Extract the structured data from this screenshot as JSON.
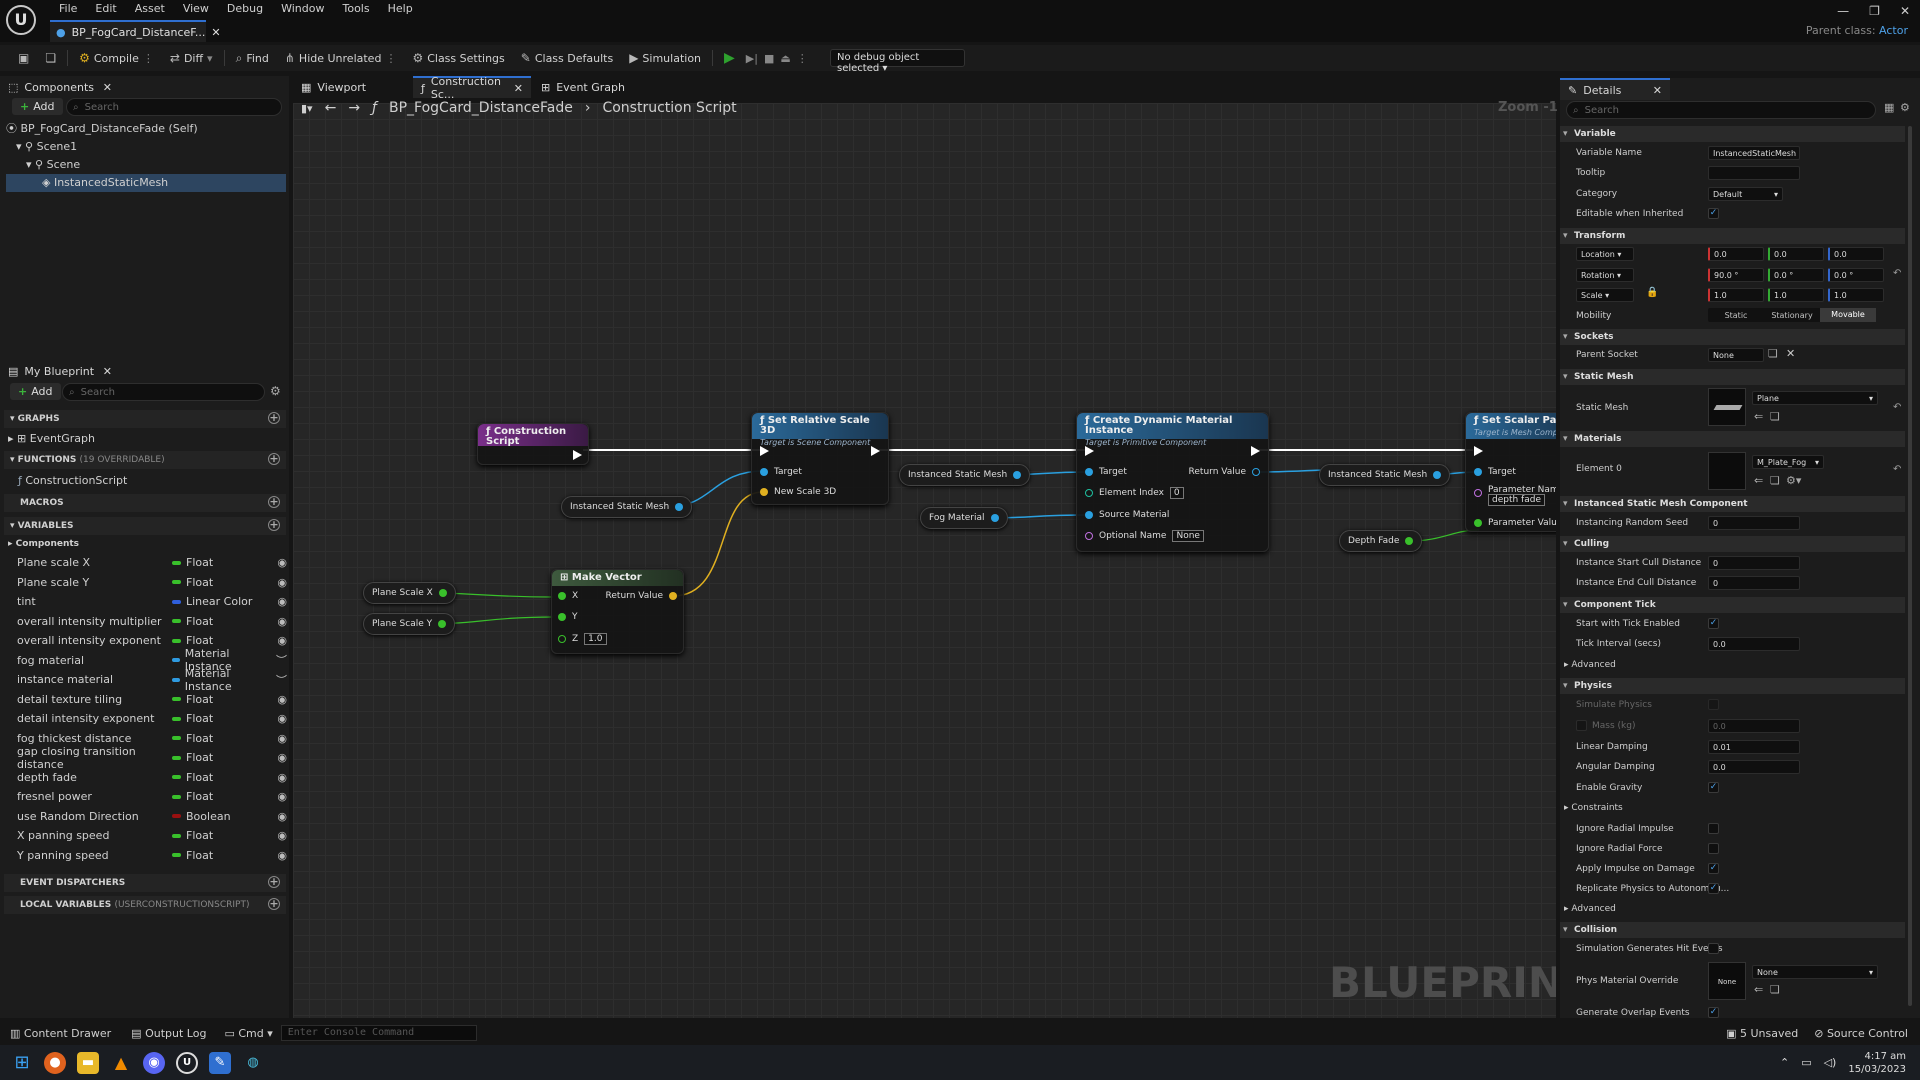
{
  "menu": [
    "File",
    "Edit",
    "Asset",
    "View",
    "Debug",
    "Window",
    "Tools",
    "Help"
  ],
  "doc_tab": "BP_FogCard_DistanceF...",
  "parent_class": {
    "label": "Parent class:",
    "value": "Actor"
  },
  "toolbar": {
    "compile": "Compile",
    "diff": "Diff",
    "find": "Find",
    "hide_unrelated": "Hide Unrelated",
    "class_settings": "Class Settings",
    "class_defaults": "Class Defaults",
    "simulation": "Simulation",
    "debug_object": "No debug object selected"
  },
  "components": {
    "tab": "Components",
    "add": "Add",
    "search": "Search",
    "tree": [
      "BP_FogCard_DistanceFade (Self)",
      "Scene1",
      "Scene",
      "InstancedStaticMesh"
    ]
  },
  "my_blueprint": {
    "tab": "My Blueprint",
    "add": "Add",
    "search": "Search",
    "graphs": "GRAPHS",
    "event_graph": "EventGraph",
    "functions": "FUNCTIONS",
    "functions_count": "(19 OVERRIDABLE)",
    "construction_script": "ConstructionScript",
    "macros": "MACROS",
    "variables": "VARIABLES",
    "components_cat": "Components",
    "vars": [
      {
        "name": "Plane scale X",
        "type": "Float",
        "color": "#39c02b"
      },
      {
        "name": "Plane scale Y",
        "type": "Float",
        "color": "#39c02b"
      },
      {
        "name": "tint",
        "type": "Linear Color",
        "color": "#2f5fdc"
      },
      {
        "name": "overall intensity multiplier",
        "type": "Float",
        "color": "#39c02b"
      },
      {
        "name": "overall intensity exponent",
        "type": "Float",
        "color": "#39c02b"
      },
      {
        "name": "fog material",
        "type": "Material Instance",
        "color": "#2f9be0"
      },
      {
        "name": "instance material",
        "type": "Material Instance",
        "color": "#2f9be0"
      },
      {
        "name": "detail texture tiling",
        "type": "Float",
        "color": "#39c02b"
      },
      {
        "name": "detail intensity exponent",
        "type": "Float",
        "color": "#39c02b"
      },
      {
        "name": "fog thickest distance",
        "type": "Float",
        "color": "#39c02b"
      },
      {
        "name": "gap closing transition distance",
        "type": "Float",
        "color": "#39c02b"
      },
      {
        "name": "depth fade",
        "type": "Float",
        "color": "#39c02b"
      },
      {
        "name": "fresnel power",
        "type": "Float",
        "color": "#39c02b"
      },
      {
        "name": "use Random Direction",
        "type": "Boolean",
        "color": "#9a1010"
      },
      {
        "name": "X panning speed",
        "type": "Float",
        "color": "#39c02b"
      },
      {
        "name": "Y panning speed",
        "type": "Float",
        "color": "#39c02b"
      }
    ],
    "event_dispatchers": "EVENT DISPATCHERS",
    "local_variables": "LOCAL VARIABLES",
    "local_variables_sub": "(USERCONSTRUCTIONSCRIPT)"
  },
  "graph_tabs": [
    "Viewport",
    "Construction Sc...",
    "Event Graph"
  ],
  "breadcrumb": {
    "bp": "BP_FogCard_DistanceFade",
    "graph": "Construction Script"
  },
  "zoom": "Zoom -1",
  "watermark": "BLUEPRINT",
  "nodes": {
    "construction_script": "Construction Script",
    "set_relative_scale": {
      "title": "Set Relative Scale 3D",
      "sub": "Target is Scene Component",
      "target": "Target",
      "new_scale": "New Scale 3D"
    },
    "make_vector": {
      "title": "Make Vector",
      "x": "X",
      "y": "Y",
      "z": "Z",
      "z_val": "1.0",
      "ret": "Return Value"
    },
    "create_dmi": {
      "title": "Create Dynamic Material Instance",
      "sub": "Target is Primitive Component",
      "target": "Target",
      "element_index": "Element Index",
      "element_index_val": "0",
      "source_material": "Source Material",
      "optional_name": "Optional Name",
      "optional_name_val": "None",
      "ret": "Return Value"
    },
    "set_scalar": {
      "title": "Set Scalar Parame",
      "sub": "Target is Mesh Comp",
      "target": "Target",
      "param_name": "Parameter Name",
      "param_name_val": "depth fade",
      "param_value": "Parameter Value"
    },
    "var_ism": "Instanced Static Mesh",
    "var_fog": "Fog Material",
    "var_depth": "Depth Fade",
    "var_px": "Plane Scale X",
    "var_py": "Plane Scale Y"
  },
  "details": {
    "tab": "Details",
    "search": "Search",
    "variable": "Variable",
    "variable_name_l": "Variable Name",
    "variable_name": "InstancedStaticMesh",
    "tooltip_l": "Tooltip",
    "category_l": "Category",
    "category": "Default",
    "editable_l": "Editable when Inherited",
    "transform": "Transform",
    "location": "Location",
    "rotation": "Rotation",
    "scale": "Scale",
    "loc": [
      "0.0",
      "0.0",
      "0.0"
    ],
    "rot": [
      "90.0 °",
      "0.0 °",
      "0.0 °"
    ],
    "scl": [
      "1.0",
      "1.0",
      "1.0"
    ],
    "mobility_l": "Mobility",
    "mobility": [
      "Static",
      "Stationary",
      "Movable"
    ],
    "sockets": "Sockets",
    "parent_socket_l": "Parent Socket",
    "parent_socket": "None",
    "static_mesh_s": "Static Mesh",
    "static_mesh_l": "Static Mesh",
    "static_mesh": "Plane",
    "materials": "Materials",
    "element0_l": "Element 0",
    "element0": "M_Plate_Fog",
    "ismc": "Instanced Static Mesh Component",
    "seed_l": "Instancing Random Seed",
    "seed": "0",
    "culling": "Culling",
    "start_cull_l": "Instance Start Cull Distance",
    "start_cull": "0",
    "end_cull_l": "Instance End Cull Distance",
    "end_cull": "0",
    "component_tick": "Component Tick",
    "tick_enabled_l": "Start with Tick Enabled",
    "tick_interval_l": "Tick Interval (secs)",
    "tick_interval": "0.0",
    "advanced": "Advanced",
    "physics": "Physics",
    "sim_physics_l": "Simulate Physics",
    "mass_l": "Mass (kg)",
    "mass": "0.0",
    "lin_damp_l": "Linear Damping",
    "lin_damp": "0.01",
    "ang_damp_l": "Angular Damping",
    "ang_damp": "0.0",
    "gravity_l": "Enable Gravity",
    "constraints": "Constraints",
    "ign_impulse_l": "Ignore Radial Impulse",
    "ign_force_l": "Ignore Radial Force",
    "apply_impulse_l": "Apply Impulse on Damage",
    "replicate_l": "Replicate Physics to Autonomou...",
    "collision": "Collision",
    "sim_hit_l": "Simulation Generates Hit Events",
    "phys_mat_l": "Phys Material Override",
    "phys_mat": "None",
    "phys_mat_thumb": "None",
    "overlap_l": "Generate Overlap Events"
  },
  "status": {
    "content_drawer": "Content Drawer",
    "output_log": "Output Log",
    "cmd": "Cmd",
    "console": "Enter Console Command",
    "unsaved": "5 Unsaved",
    "source_control": "Source Control"
  },
  "clock": {
    "time": "4:17 am",
    "date": "15/03/2023"
  }
}
